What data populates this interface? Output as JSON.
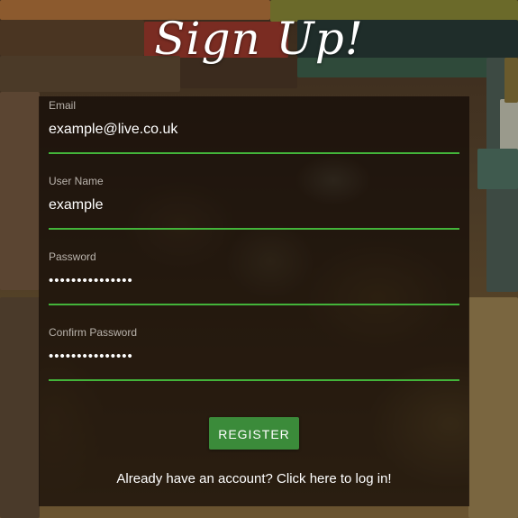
{
  "page": {
    "title": "Sign Up!"
  },
  "form": {
    "email": {
      "label": "Email",
      "value": "example@live.co.uk"
    },
    "username": {
      "label": "User Name",
      "value": "example"
    },
    "password": {
      "label": "Password",
      "value": "•••••••••••••••"
    },
    "confirm_password": {
      "label": "Confirm Password",
      "value": "•••••••••••••••"
    },
    "register_label": "REGISTER",
    "login_link_text": "Already have an account? Click here to log in!"
  },
  "colors": {
    "accent_green": "#43b43a",
    "button_green": "#3b8b3a",
    "panel_overlay": "rgba(18,10,6,0.72)"
  }
}
